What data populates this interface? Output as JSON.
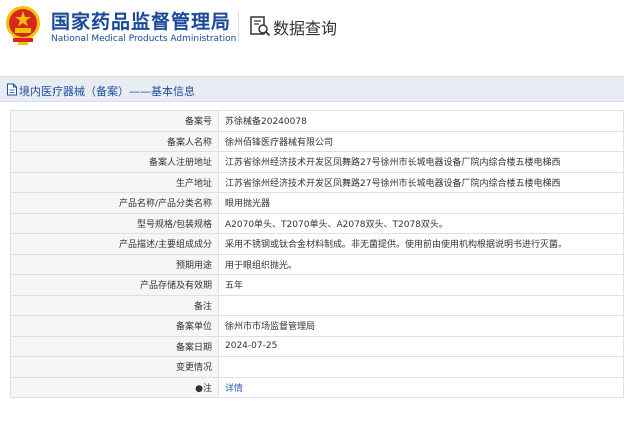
{
  "header": {
    "org_name_cn": "国家药品监督管理局",
    "org_name_en": "National Medical Products Administration",
    "page_title": "数据查询"
  },
  "section": {
    "title": "境内医疗器械（备案）——基本信息"
  },
  "rows": [
    {
      "label": "备案号",
      "value": "苏徐械备20240078"
    },
    {
      "label": "备案人名称",
      "value": "徐州佰锋医疗器械有限公司"
    },
    {
      "label": "备案人注册地址",
      "value": "江苏省徐州经济技术开发区凤舞路27号徐州市长城电器设备厂院内综合楼五楼电梯西"
    },
    {
      "label": "生产地址",
      "value": "江苏省徐州经济技术开发区凤舞路27号徐州市长城电器设备厂院内综合楼五楼电梯西"
    },
    {
      "label": "产品名称/产品分类名称",
      "value": "眼用抛光器"
    },
    {
      "label": "型号规格/包装规格",
      "value": "A2070单头、T2070单头、A2078双头、T2078双头。"
    },
    {
      "label": "产品描述/主要组成成分",
      "value": "采用不锈钢或钛合金材料制成。非无菌提供。使用前由使用机构根据说明书进行灭菌。"
    },
    {
      "label": "预期用途",
      "value": "用于眼组织抛光。"
    },
    {
      "label": "产品存储及有效期",
      "value": "五年"
    },
    {
      "label": "备注",
      "value": ""
    },
    {
      "label": "备案单位",
      "value": "徐州市市场监督管理局"
    },
    {
      "label": "备案日期",
      "value": "2024-07-25"
    },
    {
      "label": "变更情况",
      "value": ""
    },
    {
      "label": "注",
      "value": "详情"
    }
  ],
  "colors": {
    "brand_blue": "#1a4a97",
    "emblem_red": "#d7261e",
    "emblem_gold": "#f2c200",
    "link_blue": "#2a5db0"
  }
}
